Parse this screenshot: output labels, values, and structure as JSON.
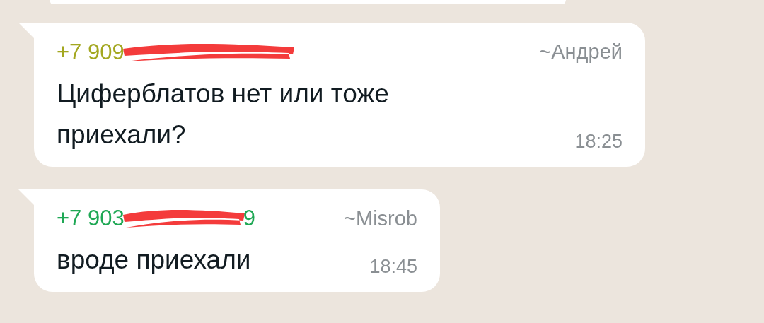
{
  "messages": [
    {
      "phone": "+7 909",
      "color": "#a3a720",
      "author": "~Андрей",
      "text": "Циферблатов нет или тоже приехали?",
      "time": "18:25"
    },
    {
      "phone": "+7 903",
      "phone_tail": "9",
      "color": "#1fa855",
      "author": "~Misrob",
      "text": "вроде приехали",
      "time": "18:45"
    }
  ]
}
